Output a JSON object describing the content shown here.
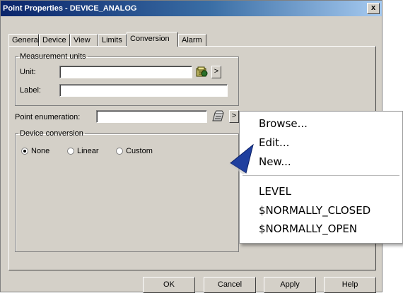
{
  "window": {
    "title": "Point Properties - DEVICE_ANALOG",
    "close_label": "x"
  },
  "tabs": [
    "General",
    "Device",
    "View",
    "Limits",
    "Conversion",
    "Alarm"
  ],
  "active_tab": "Conversion",
  "measurement_units": {
    "legend": "Measurement units",
    "unit_label": "Unit:",
    "unit_value": "",
    "label_label": "Label:",
    "label_value": "",
    "arrow": ">"
  },
  "point_enumeration": {
    "label": "Point enumeration:",
    "value": "",
    "arrow": ">"
  },
  "device_conversion": {
    "legend": "Device conversion",
    "options": [
      "None",
      "Linear",
      "Custom"
    ],
    "selected": "None"
  },
  "buttons": {
    "ok": "OK",
    "cancel": "Cancel",
    "apply": "Apply",
    "help": "Help"
  },
  "context_menu": {
    "items": [
      "Browse...",
      "Edit...",
      "New..."
    ],
    "enumerations": [
      "LEVEL",
      "$NORMALLY_CLOSED",
      "$NORMALLY_OPEN"
    ]
  },
  "colors": {
    "titlebar_start": "#0a246a",
    "titlebar_end": "#a6caf0",
    "dialog_bg": "#d4d0c8",
    "pointer": "#1f3f9f"
  }
}
